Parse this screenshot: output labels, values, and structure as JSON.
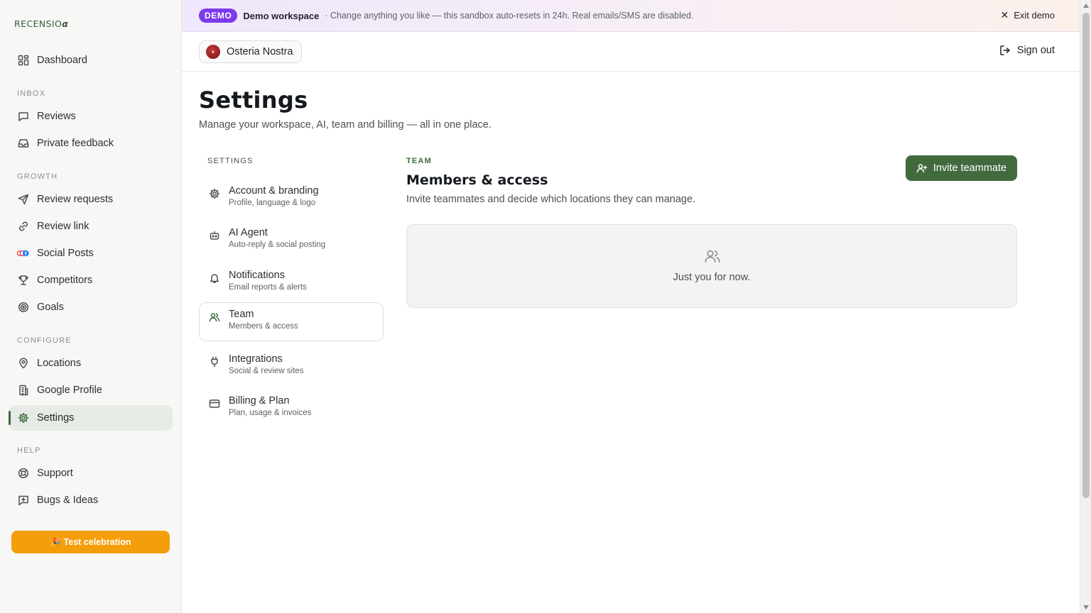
{
  "brand": {
    "name": "RECENSIO",
    "glyph": "α"
  },
  "sidebar": {
    "items": [
      {
        "label": "Dashboard"
      },
      {
        "label": "Reviews"
      },
      {
        "label": "Private feedback"
      },
      {
        "label": "Review requests"
      },
      {
        "label": "Review link"
      },
      {
        "label": "Social Posts"
      },
      {
        "label": "Competitors"
      },
      {
        "label": "Goals"
      },
      {
        "label": "Locations"
      },
      {
        "label": "Google Profile"
      },
      {
        "label": "Settings"
      },
      {
        "label": "Support"
      },
      {
        "label": "Bugs & Ideas"
      }
    ],
    "sections": {
      "inbox": "INBOX",
      "growth": "GROWTH",
      "configure": "CONFIGURE",
      "help": "HELP"
    },
    "active": "Settings",
    "celebrate_label": "🎉 Test celebration"
  },
  "banner": {
    "pill": "DEMO",
    "workspace": "Demo workspace",
    "note": "· Change anything you like — this sandbox auto-resets in 24h. Real emails/SMS are disabled.",
    "exit_label": "Exit demo"
  },
  "topbar": {
    "location": "Osteria Nostra",
    "signout_label": "Sign out"
  },
  "page": {
    "title": "Settings",
    "subtitle": "Manage your workspace, AI, team and billing — all in one place."
  },
  "settings_nav": {
    "label": "SETTINGS",
    "items": [
      {
        "title": "Account & branding",
        "sub": "Profile, language & logo"
      },
      {
        "title": "AI Agent",
        "sub": "Auto-reply & social posting"
      },
      {
        "title": "Notifications",
        "sub": "Email reports & alerts"
      },
      {
        "title": "Team",
        "sub": "Members & access"
      },
      {
        "title": "Integrations",
        "sub": "Social & review sites"
      },
      {
        "title": "Billing & Plan",
        "sub": "Plan, usage & invoices"
      }
    ],
    "active": "Team"
  },
  "team": {
    "eyebrow": "TEAM",
    "title": "Members & access",
    "subtitle": "Invite teammates and decide which locations they can manage.",
    "invite_label": "Invite teammate",
    "empty_text": "Just you for now."
  },
  "colors": {
    "accent": "#416b3f",
    "demo": "#7c3aed",
    "celebrate": "#f59e0b"
  }
}
